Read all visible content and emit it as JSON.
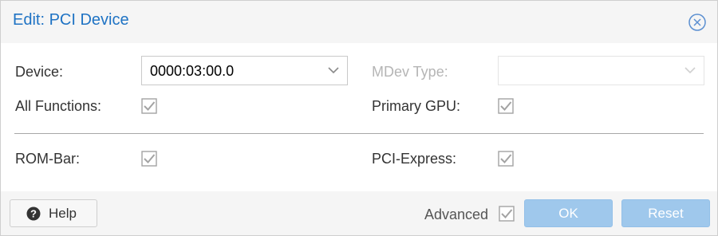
{
  "dialog": {
    "title": "Edit: PCI Device"
  },
  "form": {
    "device_label": "Device:",
    "device_value": "0000:03:00.0",
    "mdev_type_label": "MDev Type:",
    "mdev_type_value": "",
    "all_functions_label": "All Functions:",
    "all_functions_checked": true,
    "primary_gpu_label": "Primary GPU:",
    "primary_gpu_checked": true,
    "rom_bar_label": "ROM-Bar:",
    "rom_bar_checked": true,
    "pci_express_label": "PCI-Express:",
    "pci_express_checked": true
  },
  "footer": {
    "help_label": "Help",
    "advanced_label": "Advanced",
    "advanced_checked": true,
    "ok_label": "OK",
    "reset_label": "Reset"
  },
  "colors": {
    "title": "#1f73c4",
    "button_disabled_blue": "#9fc8ec",
    "checkbox_gray": "#a3a3a3"
  },
  "icons": {
    "close": "circle-x-icon",
    "help": "question-circle-icon",
    "dropdown": "chevron-down-icon",
    "checkbox": "checkmark-box-icon"
  }
}
